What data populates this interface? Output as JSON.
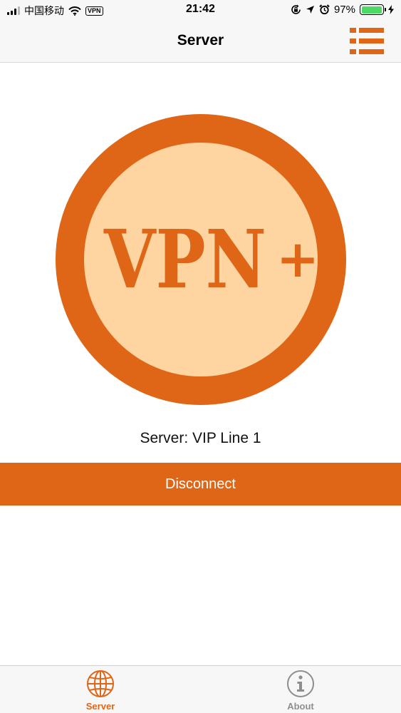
{
  "status_bar": {
    "carrier": "中国移动",
    "vpn_badge": "VPN",
    "time": "21:42",
    "battery_percent": "97%",
    "battery_level": 0.97
  },
  "nav": {
    "title": "Server",
    "list_icon": "list-icon"
  },
  "logo": {
    "text": "VPN",
    "plus": "+",
    "ring_color": "#e06617",
    "fill_color": "#fed4a0"
  },
  "connection": {
    "server_label": "Server: VIP Line 1",
    "disconnect_label": "Disconnect"
  },
  "tabs": [
    {
      "label": "Server",
      "icon": "globe-icon",
      "active": true
    },
    {
      "label": "About",
      "icon": "info-icon",
      "active": false
    }
  ],
  "colors": {
    "accent": "#e06617",
    "inactive": "#8e8e8e",
    "battery": "#4cd964"
  }
}
